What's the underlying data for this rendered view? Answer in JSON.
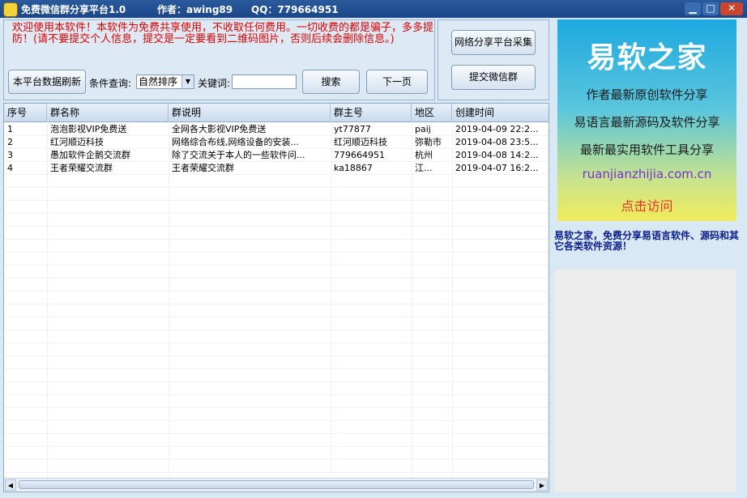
{
  "titlebar": {
    "app_title": "免费微信群分享平台1.0",
    "author": "作者：awing89",
    "qq": "QQ：779664951",
    "minimize": "▁",
    "maximize": "□",
    "close": "✕"
  },
  "welcome_text": "欢迎使用本软件！本软件为免费共享使用，不收取任何费用。一切收费的都是骗子，多多提防！(请不要提交个人信息，提交是一定要看到二维码图片，否则后续会删除信息。)",
  "toolbar": {
    "refresh_label": "本平台数据刷新",
    "filter_label": "条件查询:",
    "sort_value": "自然排序",
    "keyword_label": "关键词:",
    "keyword_value": "",
    "search_label": "搜索",
    "next_label": "下一页",
    "collect_label": "网络分享平台采集",
    "submit_label": "提交微信群"
  },
  "table": {
    "columns": [
      "序号",
      "群名称",
      "群说明",
      "群主号",
      "地区",
      "创建时间"
    ],
    "rows": [
      [
        "1",
        "泡泡影视VIP免费送",
        "全网各大影视VIP免费送",
        "yt77877",
        "paij",
        "2019-04-09 22:2..."
      ],
      [
        "2",
        "红河顺迈科技",
        "网络综合布线,网络设备的安装...",
        "红河顺迈科技",
        "弥勒市",
        "2019-04-08 23:5..."
      ],
      [
        "3",
        "愚加软件企鹅交流群",
        "除了交流关于本人的一些软件问...",
        "779664951",
        "杭州",
        "2019-04-08 14:2..."
      ],
      [
        "4",
        "王者荣耀交流群",
        "王者荣耀交流群",
        "ka18867",
        "江...",
        "2019-04-07 16:2..."
      ]
    ]
  },
  "ad": {
    "title": "易软之家",
    "line1": "作者最新原创软件分享",
    "line2": "易语言最新源码及软件分享",
    "line3": "最新最实用软件工具分享",
    "url": "ruanjianzhijia.com.cn",
    "visit": "点击访问"
  },
  "promo_text": "易软之家，免费分享易语言软件、源码和其它各类软件资源！",
  "colors": {
    "titlebar": "#1b4688",
    "warning_text": "#e00000",
    "promo_text": "#0c1e8a"
  }
}
